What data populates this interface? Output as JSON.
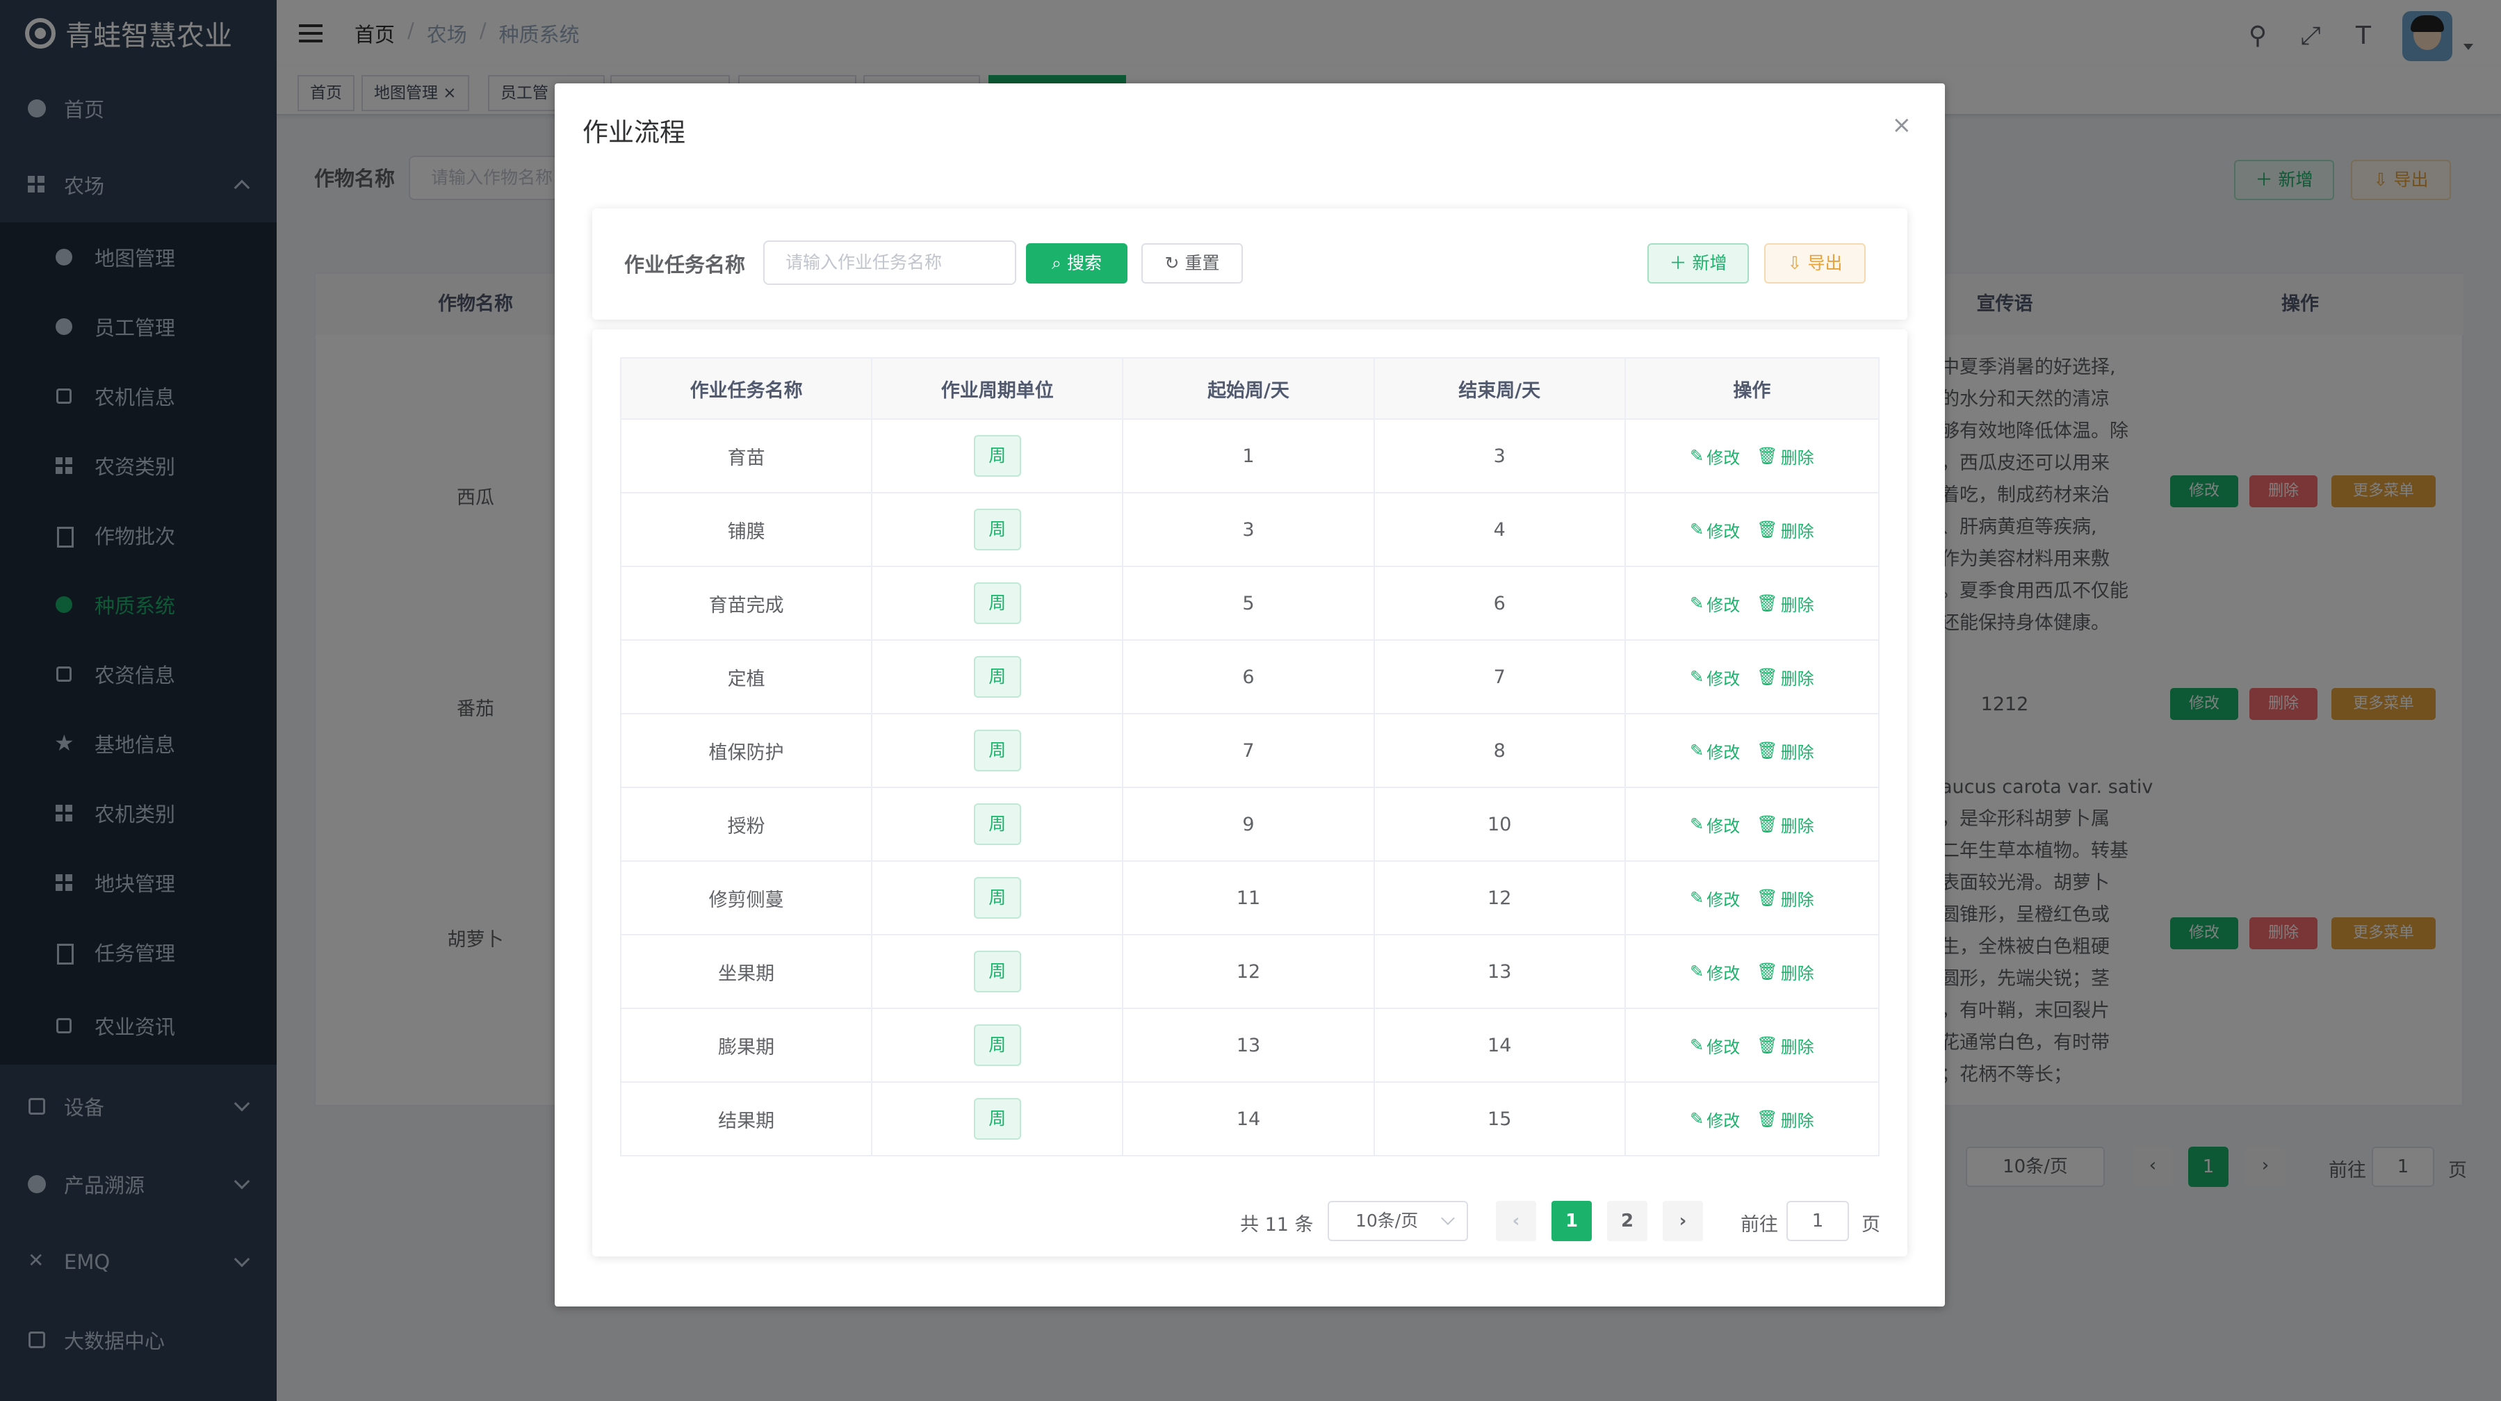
{
  "app": {
    "title": "青蛙智慧农业"
  },
  "sidebar": {
    "top_items": [
      {
        "label": "首页",
        "icon": "dashboard-icon"
      },
      {
        "label": "农场",
        "icon": "grid-icon"
      }
    ],
    "sub_items": [
      {
        "label": "地图管理",
        "icon": "globe-icon"
      },
      {
        "label": "员工管理",
        "icon": "people-icon"
      },
      {
        "label": "农机信息",
        "icon": "tractor-icon"
      },
      {
        "label": "农资类别",
        "icon": "grid-icon"
      },
      {
        "label": "作物批次",
        "icon": "copy-icon"
      },
      {
        "label": "种质系统",
        "icon": "plant-icon"
      },
      {
        "label": "农资信息",
        "icon": "box-icon"
      },
      {
        "label": "基地信息",
        "icon": "star-icon"
      },
      {
        "label": "农机类别",
        "icon": "grid-icon"
      },
      {
        "label": "地块管理",
        "icon": "grid-icon"
      },
      {
        "label": "任务管理",
        "icon": "copy-icon"
      },
      {
        "label": "农业资讯",
        "icon": "news-icon"
      }
    ],
    "bottom_items": [
      {
        "label": "设备",
        "icon": "layers-icon"
      },
      {
        "label": "产品溯源",
        "icon": "circle-icon"
      },
      {
        "label": "EMQ",
        "icon": "tools-icon"
      },
      {
        "label": "大数据中心",
        "icon": "monitor-icon"
      }
    ],
    "active_label": "种质系统"
  },
  "navbar": {
    "breadcrumb": [
      "首页",
      "农场",
      "种质系统"
    ]
  },
  "tags": [
    {
      "label": "首页"
    },
    {
      "label": "地图管理 ×"
    },
    {
      "label": "员工管"
    }
  ],
  "background": {
    "form_label": "作物名称",
    "search_placeholder": "请输入作物名称",
    "add_label": "新增",
    "export_label": "导出",
    "columns": {
      "crop_name": "作物名称",
      "slogan": "宣传语",
      "actions": "操作"
    },
    "rows": [
      {
        "name": "西瓜",
        "slogan_lines": [
          "中夏季消暑的好选择,",
          "的水分和天然的清凉",
          "够有效地降低体温。除",
          "，西瓜皮还可以用来",
          "着吃，制成药材来治",
          "、肝病黄疸等疾病,",
          "作为美容材料用来敷",
          "。夏季食用西瓜不仅能",
          "还能保持身体健康。"
        ]
      },
      {
        "name": "番茄",
        "slogan_lines": [
          "1212"
        ]
      },
      {
        "name": "胡萝卜",
        "slogan_lines": [
          "aucus carota var. sativ",
          "，是伞形科胡萝卜属",
          "二年生草本植物。转基",
          "表面较光滑。胡萝卜",
          "圆锥形，呈橙红色或",
          "生，全株被白色粗硬",
          "圆形，先端尖锐；茎",
          "，有叶鞘，末回裂片",
          "花通常白色，有时带",
          "；花柄不等长；"
        ]
      }
    ],
    "row_actions": {
      "edit": "修改",
      "delete": "删除",
      "more": "更多菜单"
    },
    "pager": {
      "size": "10条/页",
      "current": "1",
      "goto": "前往",
      "jump": "1",
      "page": "页"
    }
  },
  "modal": {
    "title": "作业流程",
    "close_label": "×",
    "search": {
      "label": "作业任务名称",
      "placeholder": "请输入作业任务名称",
      "search_label": "搜索",
      "reset_label": "重置",
      "add_label": "新增",
      "export_label": "导出"
    },
    "table": {
      "headers": [
        "作业任务名称",
        "作业周期单位",
        "起始周/天",
        "结束周/天",
        "操作"
      ],
      "rows": [
        {
          "name": "育苗",
          "unit": "周",
          "start": "1",
          "end": "3"
        },
        {
          "name": "铺膜",
          "unit": "周",
          "start": "3",
          "end": "4"
        },
        {
          "name": "育苗完成",
          "unit": "周",
          "start": "5",
          "end": "6"
        },
        {
          "name": "定植",
          "unit": "周",
          "start": "6",
          "end": "7"
        },
        {
          "name": "植保防护",
          "unit": "周",
          "start": "7",
          "end": "8"
        },
        {
          "name": "授粉",
          "unit": "周",
          "start": "9",
          "end": "10"
        },
        {
          "name": "修剪侧蔓",
          "unit": "周",
          "start": "11",
          "end": "12"
        },
        {
          "name": "坐果期",
          "unit": "周",
          "start": "12",
          "end": "13"
        },
        {
          "name": "膨果期",
          "unit": "周",
          "start": "13",
          "end": "14"
        },
        {
          "name": "结果期",
          "unit": "周",
          "start": "14",
          "end": "15"
        }
      ],
      "edit_label": "修改",
      "delete_label": "删除"
    },
    "pager": {
      "total": "共 11 条",
      "size": "10条/页",
      "pages": [
        "1",
        "2"
      ],
      "current": "1",
      "goto": "前往",
      "jump": "1",
      "page": "页"
    }
  },
  "colors": {
    "accent": "#1bb36b",
    "sidebar": "#304156",
    "submenu": "#1f2d3d",
    "danger": "#f56c6c",
    "warning": "#e6a23c"
  }
}
